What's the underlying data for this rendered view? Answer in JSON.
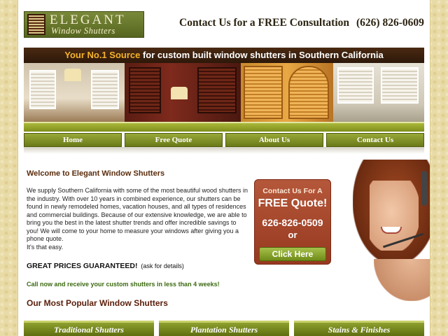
{
  "header": {
    "logo_line1": "ELEGANT",
    "logo_line2": "Window Shutters",
    "contact_text": "Contact Us for a FREE Consultation",
    "contact_phone": "(626) 826-0609"
  },
  "banner": {
    "tagline_highlight": "Your No.1 Source",
    "tagline_rest": " for custom built window shutters in Southern California"
  },
  "nav": {
    "items": [
      {
        "label": "Home"
      },
      {
        "label": "Free Quote"
      },
      {
        "label": "About Us"
      },
      {
        "label": "Contact Us"
      }
    ]
  },
  "main": {
    "welcome_title": "Welcome to Elegant Window Shutters",
    "intro_text": "We supply Southern California with some of the most beautiful wood shutters in the industry. With over 10 years in combined experience, our shutters can be found in newly remodeled homes, vacation houses, and all types of residences and commercial buildings. Because of our extensive knowledge, we are able to bring you the best in the latest shutter trends and offer incredible savings to you! We will come to your home to measure your windows after giving you a phone quote.",
    "intro_easy": "It's that easy.",
    "guarantee_bold": "GREAT PRICES GUARANTEED!",
    "guarantee_small": "(ask for details)",
    "call_now": "Call now and receive your custom shutters in less than 4 weeks!",
    "popular_title": "Our Most Popular Window Shutters"
  },
  "quote_box": {
    "line1": "Contact Us For A",
    "line2": "FREE Quote!",
    "phone": "626-826-0509",
    "or": "or",
    "button": "Click Here"
  },
  "categories": [
    {
      "label": "Traditional Shutters"
    },
    {
      "label": "Plantation Shutters"
    },
    {
      "label": "Stains & Finishes"
    }
  ],
  "colors": {
    "background_pattern": "#e9dba6",
    "nav_green": "#7f8e1a",
    "quote_box_red": "#a84a2c",
    "heading_brown": "#5a2c0c",
    "callnow_green": "#3d6a12"
  }
}
